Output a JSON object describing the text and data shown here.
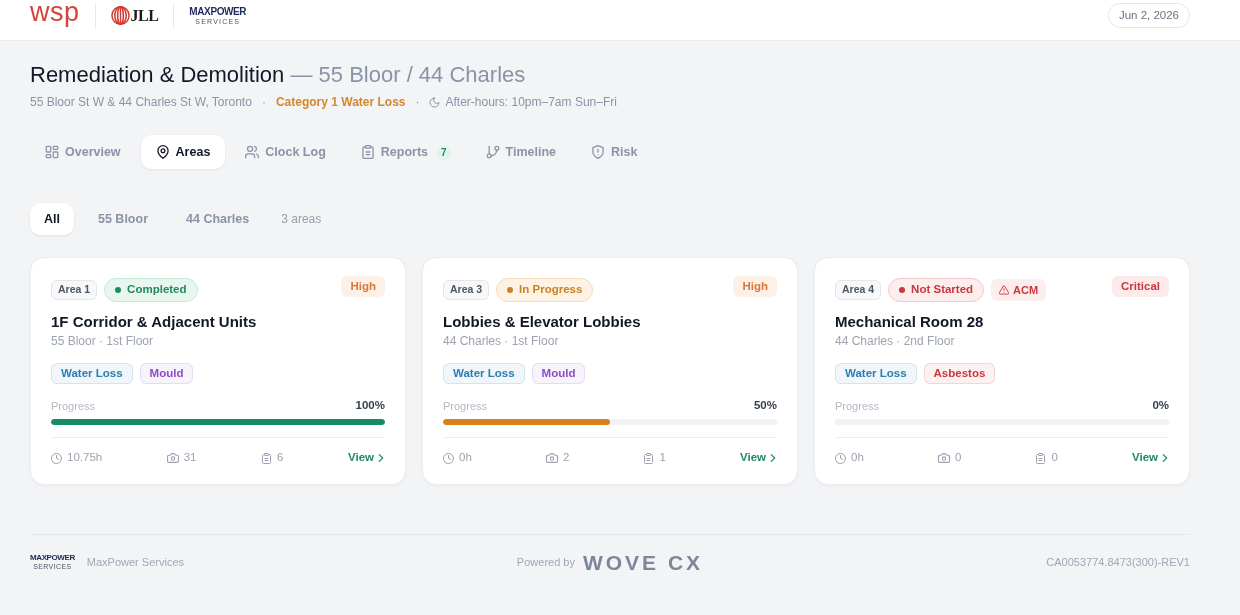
{
  "header": {
    "logos": [
      {
        "kind": "wsp",
        "text": "wsp"
      },
      {
        "kind": "jll",
        "text": "JLL"
      },
      {
        "kind": "maxpower",
        "text": "MAXPOWER",
        "subtext": "SERVICES"
      }
    ],
    "date": "Jun 2, 2026"
  },
  "project": {
    "title": "Remediation & Demolition",
    "subtitle": "— 55 Bloor / 44 Charles",
    "meta": [
      {
        "kind": "address",
        "text": "55 Bloor St W & 44 Charles St W, Toronto"
      },
      {
        "kind": "separator",
        "text": "·"
      },
      {
        "kind": "category",
        "text": "Category 1 Water Loss"
      },
      {
        "kind": "separator",
        "text": "·"
      },
      {
        "kind": "schedule",
        "text": "After-hours: 10pm–7am Sun–Fri"
      }
    ]
  },
  "tabs": [
    {
      "label": "Overview",
      "selected": false
    },
    {
      "label": "Areas",
      "selected": true
    },
    {
      "label": "Clock Log",
      "selected": false
    },
    {
      "label": "Reports",
      "selected": false,
      "badge": "7"
    },
    {
      "label": "Timeline",
      "selected": false
    },
    {
      "label": "Risk",
      "selected": false
    }
  ],
  "filters": {
    "options": [
      {
        "label": "All",
        "selected": true
      },
      {
        "label": "55 Bloor",
        "selected": false
      },
      {
        "label": "44 Charles",
        "selected": false
      }
    ],
    "count": "3 areas"
  },
  "areas": [
    {
      "area": "Area 1",
      "status": {
        "kind": "completed",
        "label": "Completed"
      },
      "priority": {
        "kind": "high",
        "label": "High"
      },
      "title": "1F Corridor & Adjacent Units",
      "location": "55 Bloor · 1st Floor",
      "tags": [
        {
          "label": "Water Loss",
          "color": "#2b7fae"
        },
        {
          "label": "Mould",
          "color": "#8b4fc4"
        }
      ],
      "progress_label": "Progress",
      "level": 1,
      "progress_text": "100%",
      "hours": "10.75h",
      "photos": "31",
      "reports": "6",
      "link": "View"
    },
    {
      "area": "Area 3",
      "status": {
        "kind": "in_progress",
        "label": "In Progress"
      },
      "priority": {
        "kind": "high",
        "label": "High"
      },
      "title": "Lobbies & Elevator Lobbies",
      "location": "44 Charles · 1st Floor",
      "tags": [
        {
          "label": "Water Loss",
          "color": "#2b7fae"
        },
        {
          "label": "Mould",
          "color": "#8b4fc4"
        }
      ],
      "progress_label": "Progress",
      "level": 0.5,
      "progress_text": "50%",
      "hours": "0h",
      "photos": "2",
      "reports": "1",
      "link": "View"
    },
    {
      "area": "Area 4",
      "status": {
        "kind": "not_started",
        "label": "Not Started"
      },
      "hazards": [
        {
          "label": "ACM"
        }
      ],
      "priority": {
        "kind": "critical",
        "label": "Critical"
      },
      "title": "Mechanical Room 28",
      "location": "44 Charles · 2nd Floor",
      "tags": [
        {
          "label": "Water Loss",
          "color": "#2b7fae"
        },
        {
          "label": "Asbestos",
          "color": "#c9383f"
        }
      ],
      "progress_label": "Progress",
      "level": 0,
      "progress_text": "0%",
      "hours": "0h",
      "photos": "0",
      "reports": "0",
      "link": "View"
    }
  ],
  "footer": {
    "logo": {
      "text": "MAXPOWER",
      "subtext": "SERVICES"
    },
    "company": "MaxPower Services",
    "powered_by": "Powered by",
    "brand": "WOVE CX",
    "code": "CA0053774.8473(300)-REV1"
  }
}
